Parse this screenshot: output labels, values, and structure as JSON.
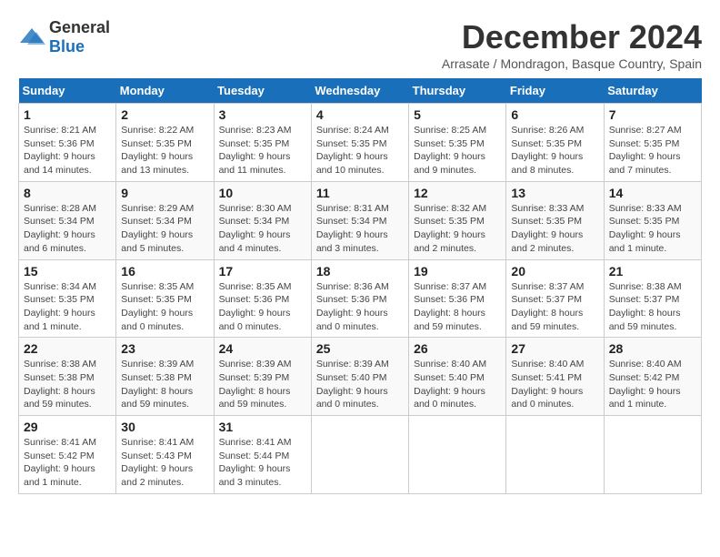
{
  "header": {
    "logo_general": "General",
    "logo_blue": "Blue",
    "month_title": "December 2024",
    "location": "Arrasate / Mondragon, Basque Country, Spain"
  },
  "days_of_week": [
    "Sunday",
    "Monday",
    "Tuesday",
    "Wednesday",
    "Thursday",
    "Friday",
    "Saturday"
  ],
  "weeks": [
    [
      {
        "day": "1",
        "sunrise": "8:21 AM",
        "sunset": "5:36 PM",
        "daylight": "9 hours and 14 minutes."
      },
      {
        "day": "2",
        "sunrise": "8:22 AM",
        "sunset": "5:35 PM",
        "daylight": "9 hours and 13 minutes."
      },
      {
        "day": "3",
        "sunrise": "8:23 AM",
        "sunset": "5:35 PM",
        "daylight": "9 hours and 11 minutes."
      },
      {
        "day": "4",
        "sunrise": "8:24 AM",
        "sunset": "5:35 PM",
        "daylight": "9 hours and 10 minutes."
      },
      {
        "day": "5",
        "sunrise": "8:25 AM",
        "sunset": "5:35 PM",
        "daylight": "9 hours and 9 minutes."
      },
      {
        "day": "6",
        "sunrise": "8:26 AM",
        "sunset": "5:35 PM",
        "daylight": "9 hours and 8 minutes."
      },
      {
        "day": "7",
        "sunrise": "8:27 AM",
        "sunset": "5:35 PM",
        "daylight": "9 hours and 7 minutes."
      }
    ],
    [
      {
        "day": "8",
        "sunrise": "8:28 AM",
        "sunset": "5:34 PM",
        "daylight": "9 hours and 6 minutes."
      },
      {
        "day": "9",
        "sunrise": "8:29 AM",
        "sunset": "5:34 PM",
        "daylight": "9 hours and 5 minutes."
      },
      {
        "day": "10",
        "sunrise": "8:30 AM",
        "sunset": "5:34 PM",
        "daylight": "9 hours and 4 minutes."
      },
      {
        "day": "11",
        "sunrise": "8:31 AM",
        "sunset": "5:34 PM",
        "daylight": "9 hours and 3 minutes."
      },
      {
        "day": "12",
        "sunrise": "8:32 AM",
        "sunset": "5:35 PM",
        "daylight": "9 hours and 2 minutes."
      },
      {
        "day": "13",
        "sunrise": "8:33 AM",
        "sunset": "5:35 PM",
        "daylight": "9 hours and 2 minutes."
      },
      {
        "day": "14",
        "sunrise": "8:33 AM",
        "sunset": "5:35 PM",
        "daylight": "9 hours and 1 minute."
      }
    ],
    [
      {
        "day": "15",
        "sunrise": "8:34 AM",
        "sunset": "5:35 PM",
        "daylight": "9 hours and 1 minute."
      },
      {
        "day": "16",
        "sunrise": "8:35 AM",
        "sunset": "5:35 PM",
        "daylight": "9 hours and 0 minutes."
      },
      {
        "day": "17",
        "sunrise": "8:35 AM",
        "sunset": "5:36 PM",
        "daylight": "9 hours and 0 minutes."
      },
      {
        "day": "18",
        "sunrise": "8:36 AM",
        "sunset": "5:36 PM",
        "daylight": "9 hours and 0 minutes."
      },
      {
        "day": "19",
        "sunrise": "8:37 AM",
        "sunset": "5:36 PM",
        "daylight": "8 hours and 59 minutes."
      },
      {
        "day": "20",
        "sunrise": "8:37 AM",
        "sunset": "5:37 PM",
        "daylight": "8 hours and 59 minutes."
      },
      {
        "day": "21",
        "sunrise": "8:38 AM",
        "sunset": "5:37 PM",
        "daylight": "8 hours and 59 minutes."
      }
    ],
    [
      {
        "day": "22",
        "sunrise": "8:38 AM",
        "sunset": "5:38 PM",
        "daylight": "8 hours and 59 minutes."
      },
      {
        "day": "23",
        "sunrise": "8:39 AM",
        "sunset": "5:38 PM",
        "daylight": "8 hours and 59 minutes."
      },
      {
        "day": "24",
        "sunrise": "8:39 AM",
        "sunset": "5:39 PM",
        "daylight": "8 hours and 59 minutes."
      },
      {
        "day": "25",
        "sunrise": "8:39 AM",
        "sunset": "5:40 PM",
        "daylight": "9 hours and 0 minutes."
      },
      {
        "day": "26",
        "sunrise": "8:40 AM",
        "sunset": "5:40 PM",
        "daylight": "9 hours and 0 minutes."
      },
      {
        "day": "27",
        "sunrise": "8:40 AM",
        "sunset": "5:41 PM",
        "daylight": "9 hours and 0 minutes."
      },
      {
        "day": "28",
        "sunrise": "8:40 AM",
        "sunset": "5:42 PM",
        "daylight": "9 hours and 1 minute."
      }
    ],
    [
      {
        "day": "29",
        "sunrise": "8:41 AM",
        "sunset": "5:42 PM",
        "daylight": "9 hours and 1 minute."
      },
      {
        "day": "30",
        "sunrise": "8:41 AM",
        "sunset": "5:43 PM",
        "daylight": "9 hours and 2 minutes."
      },
      {
        "day": "31",
        "sunrise": "8:41 AM",
        "sunset": "5:44 PM",
        "daylight": "9 hours and 3 minutes."
      },
      null,
      null,
      null,
      null
    ]
  ]
}
